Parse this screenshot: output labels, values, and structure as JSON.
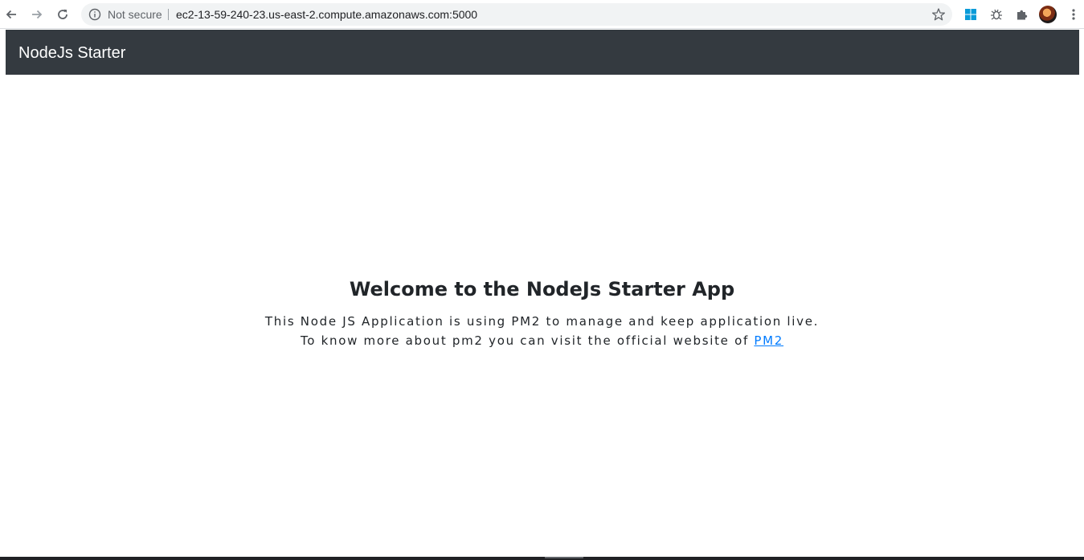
{
  "browser": {
    "security_label": "Not secure",
    "url": "ec2-13-59-240-23.us-east-2.compute.amazonaws.com:5000",
    "icons": [
      "back-arrow-icon",
      "forward-arrow-icon",
      "reload-icon",
      "info-icon",
      "star-icon",
      "windows-extension-icon",
      "bug-extension-icon",
      "puzzle-extension-icon",
      "profile-avatar",
      "menu-dots-icon"
    ]
  },
  "navbar": {
    "brand": "NodeJs Starter",
    "background": "#343a40"
  },
  "main": {
    "title": "Welcome to the NodeJs Starter App",
    "line1": "This Node JS Application is using PM2 to manage and keep application live.",
    "line2_prefix": "To know more about pm2 you can visit the official website of ",
    "link_label": "PM2",
    "link_color": "#007bff"
  }
}
